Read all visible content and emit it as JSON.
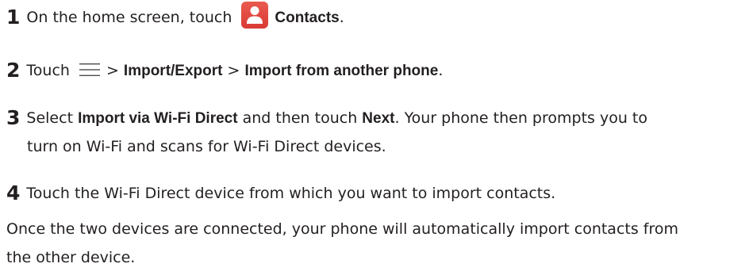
{
  "steps": [
    {
      "number": "1",
      "text_before": "On the home screen, touch",
      "bold": "Contacts",
      "text_after": "."
    },
    {
      "number": "2",
      "text_before": "Touch",
      "sep": ">",
      "bold1": "Import/Export",
      "bold2": "Import from another phone",
      "text_after": "."
    },
    {
      "number": "3",
      "text_before": "Select",
      "bold1": "Import via Wi-Fi Direct",
      "text_mid": "and then touch",
      "bold2": "Next",
      "text_after": ". Your phone then prompts you to",
      "continuation": "turn on Wi-Fi and scans for Wi-Fi Direct devices."
    },
    {
      "number": "4",
      "text": "Touch the Wi-Fi Direct device from which you want to import contacts."
    }
  ],
  "note_line1": "Once the two devices are connected, your phone will automatically import contacts from",
  "note_line2": "the other device.",
  "colors": {
    "text": "#231f20",
    "contacts_icon": "#e04a42"
  },
  "icons": [
    "contacts-icon",
    "menu-icon"
  ]
}
